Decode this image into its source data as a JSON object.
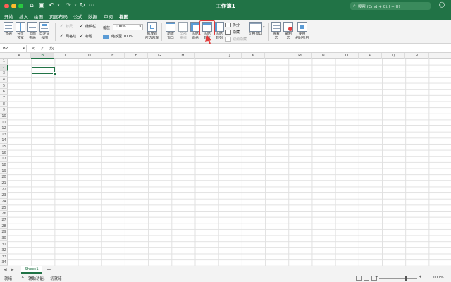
{
  "window": {
    "title": "工作簿1",
    "search_placeholder": "搜索 (Cmd + Ctrl + U)",
    "traffic_colors": [
      "#ff5f57",
      "#febc2e",
      "#28c840"
    ]
  },
  "tabs": [
    "开始",
    "插入",
    "绘图",
    "页面布局",
    "公式",
    "数据",
    "审阅",
    "视图"
  ],
  "active_tab": "视图",
  "ribbon": {
    "view_buttons": [
      {
        "label": "普通",
        "icon": "normal-view-icon"
      },
      {
        "label": "分页\n预览",
        "icon": "page-break-preview-icon"
      },
      {
        "label": "页面\n布局",
        "icon": "page-layout-icon"
      },
      {
        "label": "自定义\n视图",
        "icon": "custom-views-icon"
      }
    ],
    "checkboxes": {
      "ruler": "标尺",
      "formula_bar": "编辑栏",
      "gridlines": "网格线",
      "headings": "标题"
    },
    "zoom_label": "缩放",
    "zoom_value": "100%",
    "zoom_100": "缩放至 100%",
    "zoom_to_selection": "缩放到\n所选内容",
    "window_buttons": [
      {
        "label": "新建\n窗口",
        "icon": "new-window-icon",
        "enabled": true
      },
      {
        "label": "全部\n重排",
        "icon": "arrange-all-icon",
        "enabled": false
      },
      {
        "label": "冻结\n窗格",
        "icon": "freeze-panes-icon",
        "enabled": true
      },
      {
        "label": "冻结\n首行",
        "icon": "freeze-top-row-icon",
        "enabled": true
      },
      {
        "label": "冻结\n首列",
        "icon": "freeze-first-column-icon",
        "enabled": true
      }
    ],
    "split": "拆分",
    "hide": "隐藏",
    "unhide": "取消隐藏",
    "switch_windows": "切换窗口",
    "macro_buttons": [
      {
        "label": "查看\n宏",
        "icon": "view-macros-icon"
      },
      {
        "label": "录制\n宏",
        "icon": "record-macro-icon"
      },
      {
        "label": "使用\n相对引用",
        "icon": "relative-reference-icon"
      }
    ]
  },
  "formula_bar": {
    "name_box": "B2",
    "cancel": "✕",
    "confirm": "✓",
    "fx": "fx",
    "value": ""
  },
  "grid": {
    "columns": [
      "A",
      "B",
      "C",
      "D",
      "E",
      "F",
      "G",
      "H",
      "I",
      "J",
      "K",
      "L",
      "M",
      "N",
      "O",
      "P",
      "Q",
      "R"
    ],
    "rows": [
      "1",
      "2",
      "3",
      "4",
      "5",
      "6",
      "7",
      "8",
      "9",
      "10",
      "11",
      "12",
      "13",
      "14",
      "15",
      "16",
      "17",
      "18",
      "19",
      "20",
      "21",
      "22",
      "23",
      "24",
      "25",
      "26",
      "27",
      "28",
      "29",
      "30",
      "31",
      "32",
      "33",
      "34"
    ],
    "selected_cell": "B2"
  },
  "sheets": [
    "Sheet1"
  ],
  "status": {
    "ready": "就绪",
    "accessibility": "辅助功能: 一切就绪",
    "zoom": "100%"
  },
  "accent": "#217346",
  "highlight_color": "#e23b3b"
}
